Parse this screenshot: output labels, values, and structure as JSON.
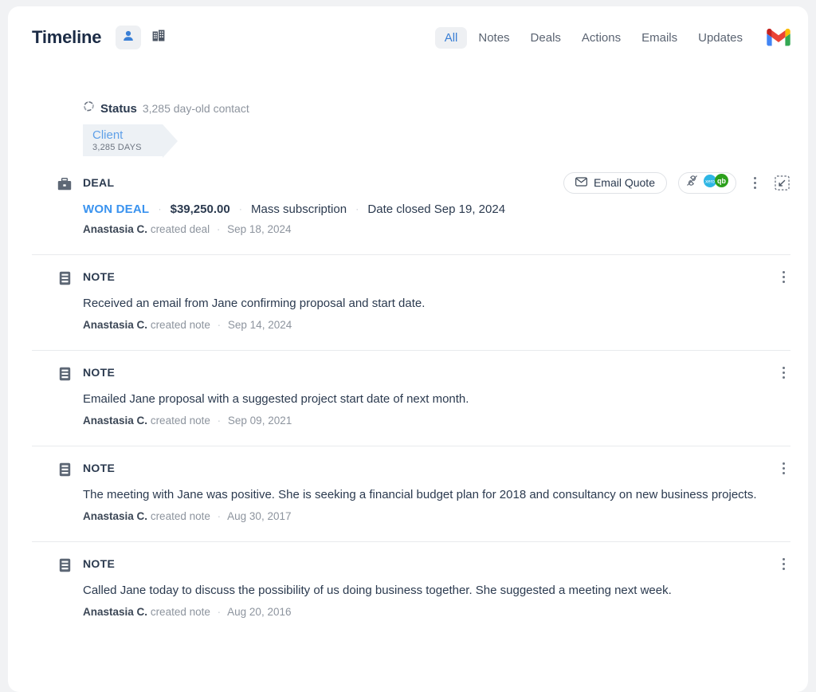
{
  "header": {
    "title": "Timeline",
    "entity_toggles": [
      {
        "name": "contact-view-toggle",
        "icon": "person-icon",
        "active": true
      },
      {
        "name": "company-view-toggle",
        "icon": "building-icon",
        "active": false
      }
    ],
    "tabs": [
      {
        "label": "All",
        "active": true
      },
      {
        "label": "Notes",
        "active": false
      },
      {
        "label": "Deals",
        "active": false
      },
      {
        "label": "Actions",
        "active": false
      },
      {
        "label": "Emails",
        "active": false
      },
      {
        "label": "Updates",
        "active": false
      }
    ],
    "gmail_icon": "gmail-logo-icon"
  },
  "status": {
    "icon": "sync-arrows-icon",
    "label": "Status",
    "subtext": "3,285 day-old contact",
    "tag": {
      "name": "Client",
      "days": "3,285 DAYS",
      "name_color": "#5fa0e8",
      "background": "#edf1f5"
    }
  },
  "deal": {
    "icon": "briefcase-icon",
    "kind": "DEAL",
    "email_quote_label": "Email Quote",
    "email_quote_icon": "envelope-icon",
    "integration_icons": [
      "plug-disconnected-icon",
      "xero-logo-icon",
      "quickbooks-logo-icon"
    ],
    "kebab_icon": "more-options-icon",
    "collapse_icon": "collapse-inward-icon",
    "status_label": "WON DEAL",
    "status_color": "#3a93ef",
    "amount": "$39,250.00",
    "product": "Mass subscription",
    "close_date": "Date closed Sep 19, 2024",
    "meta_author": "Anastasia C.",
    "meta_action": "created deal",
    "meta_date": "Sep 18, 2024"
  },
  "notes": [
    {
      "icon": "note-icon",
      "kind": "NOTE",
      "kebab_icon": "more-options-icon",
      "text": "Received an email from Jane confirming proposal and start date.",
      "meta_author": "Anastasia C.",
      "meta_action": "created note",
      "meta_date": "Sep 14, 2024"
    },
    {
      "icon": "note-icon",
      "kind": "NOTE",
      "kebab_icon": "more-options-icon",
      "text": "Emailed Jane proposal with a suggested project start date of next month.",
      "meta_author": "Anastasia C.",
      "meta_action": "created note",
      "meta_date": "Sep 09, 2021"
    },
    {
      "icon": "note-icon",
      "kind": "NOTE",
      "kebab_icon": "more-options-icon",
      "text": "The meeting with Jane was positive. She is seeking a financial budget plan for 2018 and consultancy on new business projects.",
      "meta_author": "Anastasia C.",
      "meta_action": "created note",
      "meta_date": "Aug 30, 2017"
    },
    {
      "icon": "note-icon",
      "kind": "NOTE",
      "kebab_icon": "more-options-icon",
      "text": "Called Jane today to discuss the possibility of us doing business together. She suggested a meeting next week.",
      "meta_author": "Anastasia C.",
      "meta_action": "created note",
      "meta_date": "Aug 20, 2016"
    }
  ],
  "separator": "·"
}
